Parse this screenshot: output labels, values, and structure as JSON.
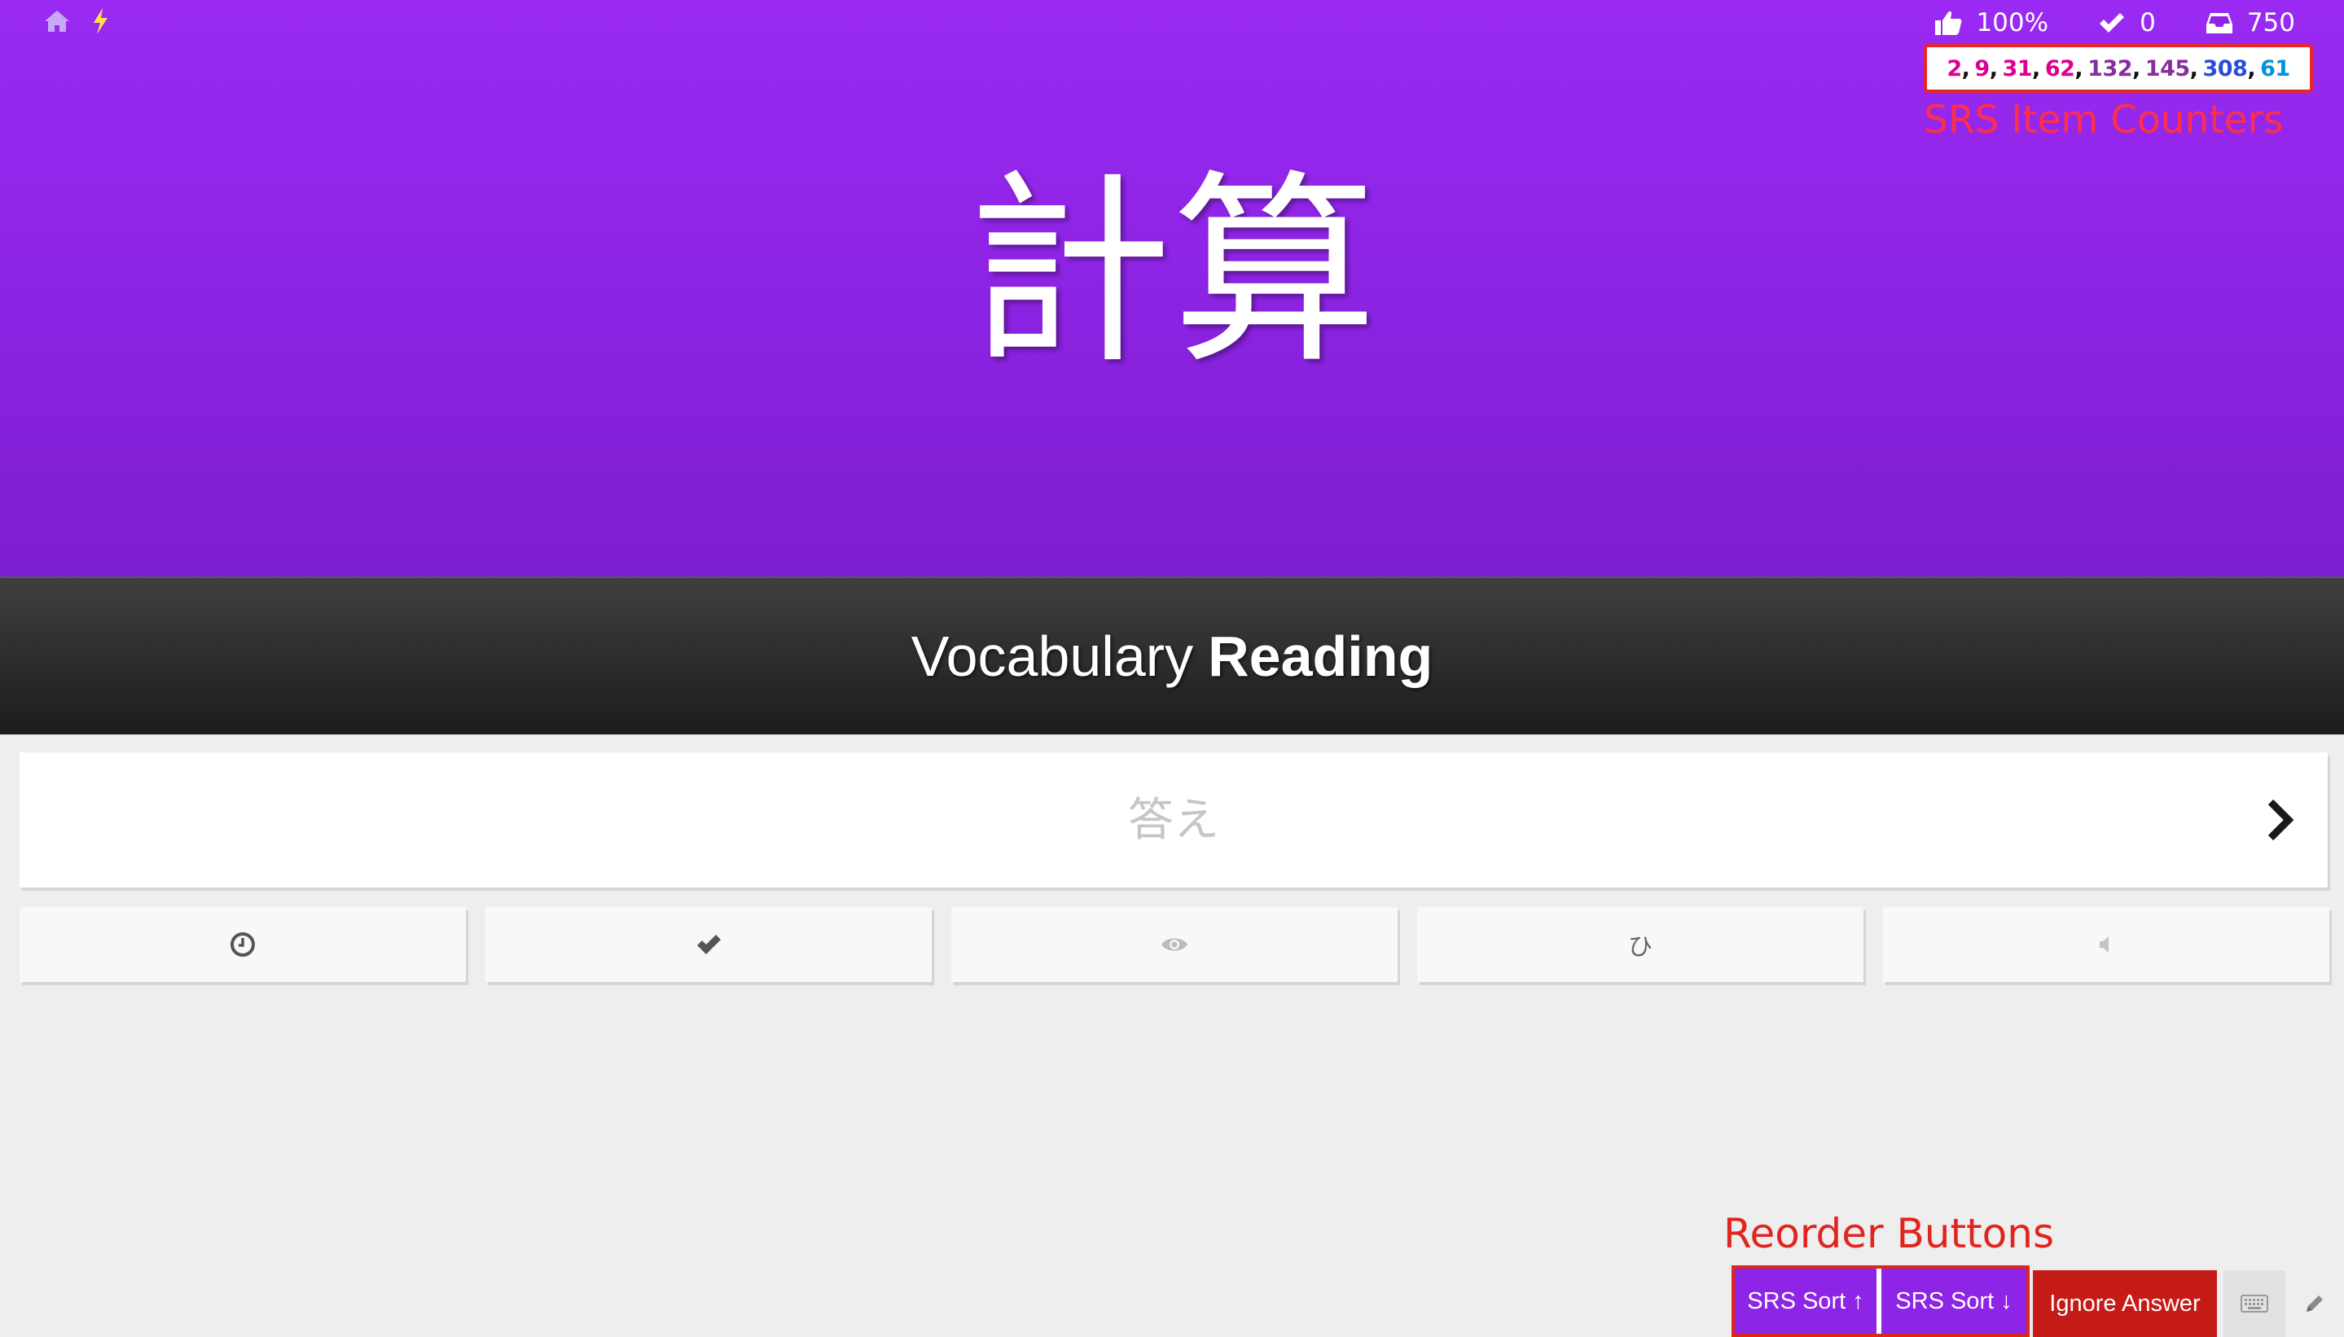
{
  "nav": {
    "home_icon": "home-icon",
    "lightning_icon": "lightning-icon"
  },
  "stats": {
    "correct_rate": "100%",
    "completed": "0",
    "remaining": "750"
  },
  "srs_counters": {
    "values": [
      "2",
      "9",
      "31",
      "62",
      "132",
      "145",
      "308",
      "61"
    ],
    "colors": [
      "#dd0093",
      "#dd0093",
      "#dd0093",
      "#dd0093",
      "#882d9e",
      "#882d9e",
      "#294ddb",
      "#0093dd"
    ],
    "separator": ","
  },
  "annotations": {
    "srs_counters": "SRS Item Counters",
    "reorder_buttons": "Reorder Buttons"
  },
  "character": "計算",
  "question_type": {
    "subject": "Vocabulary",
    "category": "Reading"
  },
  "answer": {
    "value": "",
    "placeholder": "答え"
  },
  "additional_buttons": {
    "kana_label": "ひ"
  },
  "toolbar": {
    "srs_sort_up": "SRS Sort ↑",
    "srs_sort_down": "SRS Sort ↓",
    "ignore_answer": "Ignore Answer"
  },
  "colors": {
    "header_purple": "#9a2af3",
    "reorder_button": "#8e25e6",
    "ignore_button": "#c51b16",
    "annotation_red": "#e0241e"
  }
}
